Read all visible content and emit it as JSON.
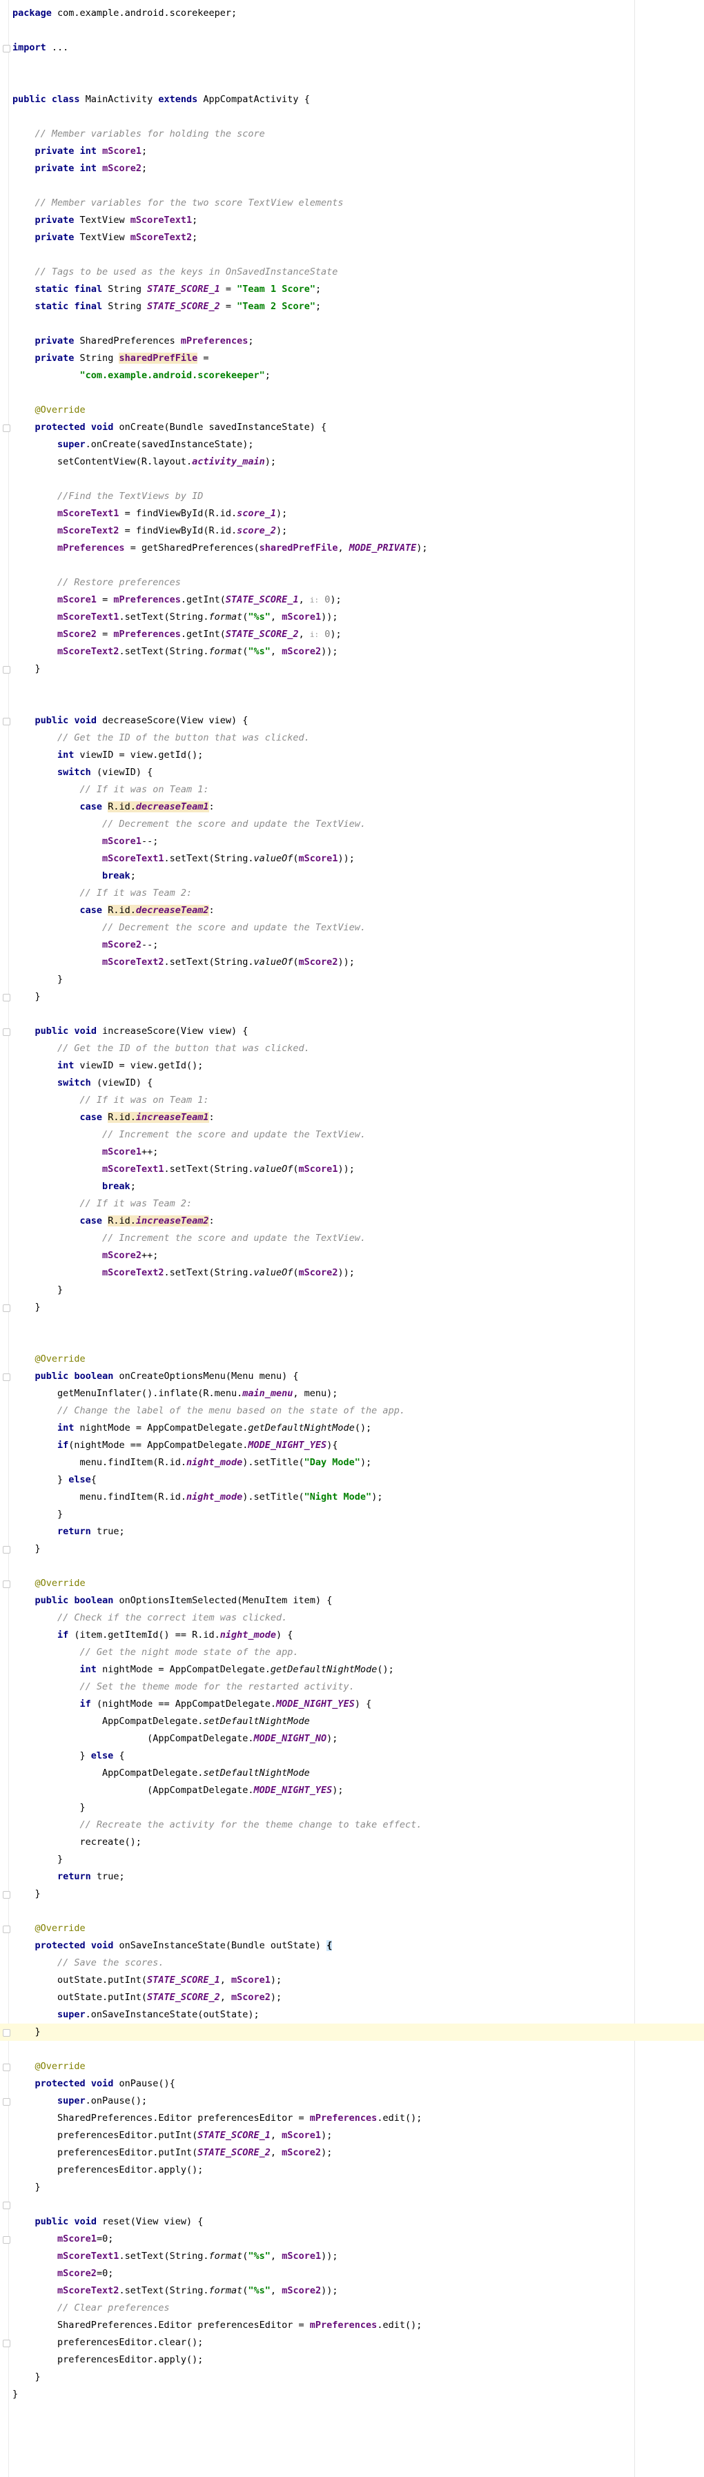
{
  "editor": {
    "file_language": "Java",
    "lines": [
      {
        "text": "package com.example.android.scorekeeper;"
      },
      {
        "text": ""
      },
      {
        "text": "import ...",
        "folded": true
      },
      {
        "text": ""
      },
      {
        "text": ""
      },
      {
        "text": "public class MainActivity extends AppCompatActivity {"
      },
      {
        "text": ""
      },
      {
        "text": "    // Member variables for holding the score"
      },
      {
        "text": "    private int mScore1;"
      },
      {
        "text": "    private int mScore2;"
      },
      {
        "text": ""
      },
      {
        "text": "    // Member variables for the two score TextView elements"
      },
      {
        "text": "    private TextView mScoreText1;"
      },
      {
        "text": "    private TextView mScoreText2;"
      },
      {
        "text": ""
      },
      {
        "text": "    // Tags to be used as the keys in OnSavedInstanceState"
      },
      {
        "text": "    static final String STATE_SCORE_1 = \"Team 1 Score\";"
      },
      {
        "text": "    static final String STATE_SCORE_2 = \"Team 2 Score\";"
      },
      {
        "text": ""
      },
      {
        "text": "    private SharedPreferences mPreferences;"
      },
      {
        "text": "    private String sharedPrefFile ="
      },
      {
        "text": "            \"com.example.android.scorekeeper\";"
      },
      {
        "text": ""
      },
      {
        "text": "    @Override"
      },
      {
        "text": "    protected void onCreate(Bundle savedInstanceState) {"
      },
      {
        "text": "        super.onCreate(savedInstanceState);"
      },
      {
        "text": "        setContentView(R.layout.activity_main);"
      },
      {
        "text": ""
      },
      {
        "text": "        //Find the TextViews by ID"
      },
      {
        "text": "        mScoreText1 = findViewById(R.id.score_1);"
      },
      {
        "text": "        mScoreText2 = findViewById(R.id.score_2);"
      },
      {
        "text": "        mPreferences = getSharedPreferences(sharedPrefFile, MODE_PRIVATE);"
      },
      {
        "text": ""
      },
      {
        "text": "        // Restore preferences"
      },
      {
        "text": "        mScore1 = mPreferences.getInt(STATE_SCORE_1, i: 0);",
        "hint": "i:"
      },
      {
        "text": "        mScoreText1.setText(String.format(\"%s\", mScore1));"
      },
      {
        "text": "        mScore2 = mPreferences.getInt(STATE_SCORE_2, i: 0);",
        "hint": "i:"
      },
      {
        "text": "        mScoreText2.setText(String.format(\"%s\", mScore2));"
      },
      {
        "text": "    }"
      },
      {
        "text": ""
      },
      {
        "text": ""
      },
      {
        "text": "    public void decreaseScore(View view) {"
      },
      {
        "text": "        // Get the ID of the button that was clicked."
      },
      {
        "text": "        int viewID = view.getId();"
      },
      {
        "text": "        switch (viewID) {"
      },
      {
        "text": "            // If it was on Team 1:"
      },
      {
        "text": "            case R.id.decreaseTeam1:"
      },
      {
        "text": "                // Decrement the score and update the TextView."
      },
      {
        "text": "                mScore1--;"
      },
      {
        "text": "                mScoreText1.setText(String.valueOf(mScore1));"
      },
      {
        "text": "                break;"
      },
      {
        "text": "            // If it was Team 2:"
      },
      {
        "text": "            case R.id.decreaseTeam2:"
      },
      {
        "text": "                // Decrement the score and update the TextView."
      },
      {
        "text": "                mScore2--;"
      },
      {
        "text": "                mScoreText2.setText(String.valueOf(mScore2));"
      },
      {
        "text": "        }"
      },
      {
        "text": "    }"
      },
      {
        "text": ""
      },
      {
        "text": "    public void increaseScore(View view) {"
      },
      {
        "text": "        // Get the ID of the button that was clicked."
      },
      {
        "text": "        int viewID = view.getId();"
      },
      {
        "text": "        switch (viewID) {"
      },
      {
        "text": "            // If it was on Team 1:"
      },
      {
        "text": "            case R.id.increaseTeam1:"
      },
      {
        "text": "                // Increment the score and update the TextView."
      },
      {
        "text": "                mScore1++;"
      },
      {
        "text": "                mScoreText1.setText(String.valueOf(mScore1));"
      },
      {
        "text": "                break;"
      },
      {
        "text": "            // If it was Team 2:"
      },
      {
        "text": "            case R.id.increaseTeam2:"
      },
      {
        "text": "                // Increment the score and update the TextView."
      },
      {
        "text": "                mScore2++;"
      },
      {
        "text": "                mScoreText2.setText(String.valueOf(mScore2));"
      },
      {
        "text": "        }"
      },
      {
        "text": "    }"
      },
      {
        "text": ""
      },
      {
        "text": ""
      },
      {
        "text": "    @Override"
      },
      {
        "text": "    public boolean onCreateOptionsMenu(Menu menu) {"
      },
      {
        "text": "        getMenuInflater().inflate(R.menu.main_menu, menu);"
      },
      {
        "text": "        // Change the label of the menu based on the state of the app."
      },
      {
        "text": "        int nightMode = AppCompatDelegate.getDefaultNightMode();"
      },
      {
        "text": "        if(nightMode == AppCompatDelegate.MODE_NIGHT_YES){"
      },
      {
        "text": "            menu.findItem(R.id.night_mode).setTitle(\"Day Mode\");"
      },
      {
        "text": "        } else{"
      },
      {
        "text": "            menu.findItem(R.id.night_mode).setTitle(\"Night Mode\");"
      },
      {
        "text": "        }"
      },
      {
        "text": "        return true;"
      },
      {
        "text": "    }"
      },
      {
        "text": ""
      },
      {
        "text": "    @Override"
      },
      {
        "text": "    public boolean onOptionsItemSelected(MenuItem item) {"
      },
      {
        "text": "        // Check if the correct item was clicked."
      },
      {
        "text": "        if (item.getItemId() == R.id.night_mode) {"
      },
      {
        "text": "            // Get the night mode state of the app."
      },
      {
        "text": "            int nightMode = AppCompatDelegate.getDefaultNightMode();"
      },
      {
        "text": "            // Set the theme mode for the restarted activity."
      },
      {
        "text": "            if (nightMode == AppCompatDelegate.MODE_NIGHT_YES) {"
      },
      {
        "text": "                AppCompatDelegate.setDefaultNightMode"
      },
      {
        "text": "                        (AppCompatDelegate.MODE_NIGHT_NO);"
      },
      {
        "text": "            } else {"
      },
      {
        "text": "                AppCompatDelegate.setDefaultNightMode"
      },
      {
        "text": "                        (AppCompatDelegate.MODE_NIGHT_YES);"
      },
      {
        "text": "            }"
      },
      {
        "text": "            // Recreate the activity for the theme change to take effect."
      },
      {
        "text": "            recreate();"
      },
      {
        "text": "        }"
      },
      {
        "text": "        return true;"
      },
      {
        "text": "    }"
      },
      {
        "text": ""
      },
      {
        "text": "    @Override"
      },
      {
        "text": "    protected void onSaveInstanceState(Bundle outState) {"
      },
      {
        "text": "        // Save the scores."
      },
      {
        "text": "        outState.putInt(STATE_SCORE_1, mScore1);"
      },
      {
        "text": "        outState.putInt(STATE_SCORE_2, mScore2);"
      },
      {
        "text": "        super.onSaveInstanceState(outState);"
      },
      {
        "text": "    }",
        "caret": true
      },
      {
        "text": ""
      },
      {
        "text": "    @Override"
      },
      {
        "text": "    protected void onPause(){"
      },
      {
        "text": "        super.onPause();"
      },
      {
        "text": "        SharedPreferences.Editor preferencesEditor = mPreferences.edit();"
      },
      {
        "text": "        preferencesEditor.putInt(STATE_SCORE_1, mScore1);"
      },
      {
        "text": "        preferencesEditor.putInt(STATE_SCORE_2, mScore2);"
      },
      {
        "text": "        preferencesEditor.apply();"
      },
      {
        "text": "    }"
      },
      {
        "text": ""
      },
      {
        "text": "    public void reset(View view) {"
      },
      {
        "text": "        mScore1=0;"
      },
      {
        "text": "        mScoreText1.setText(String.format(\"%s\", mScore1));"
      },
      {
        "text": "        mScore2=0;"
      },
      {
        "text": "        mScoreText2.setText(String.format(\"%s\", mScore2));"
      },
      {
        "text": "        // Clear preferences"
      },
      {
        "text": "        SharedPreferences.Editor preferencesEditor = mPreferences.edit();"
      },
      {
        "text": "        preferencesEditor.clear();"
      },
      {
        "text": "        preferencesEditor.apply();"
      },
      {
        "text": "    }"
      },
      {
        "text": "}"
      }
    ],
    "colors": {
      "keyword": "#000080",
      "comment": "#8c8c8c",
      "field": "#660e7a",
      "string": "#008000",
      "annotation": "#808000",
      "usage_highlight": "#f7e9c4",
      "caret_line": "#fffbdc",
      "brace_match": "#cfe6f8"
    },
    "icons": [
      "fold-marker-icon"
    ]
  }
}
